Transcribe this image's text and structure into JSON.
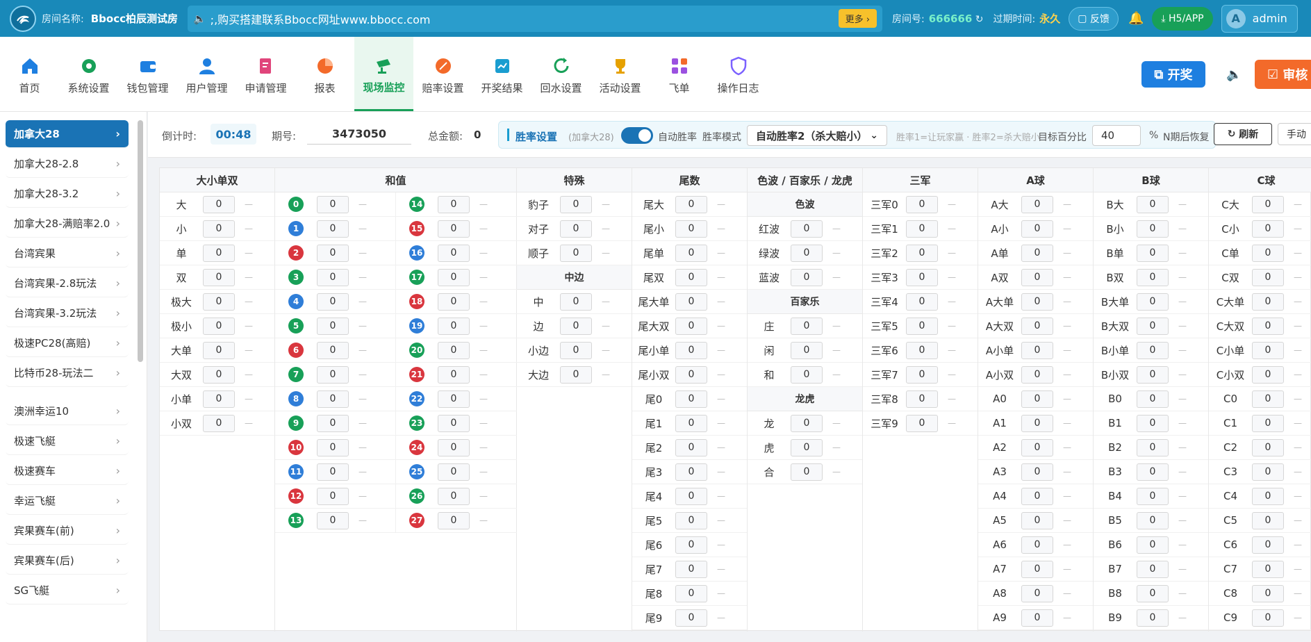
{
  "topbar": {
    "room_label": "房间名称:",
    "room_name": "Bbocc柏辰测试房",
    "marquee": ";,购买搭建联系Bbocc网址www.bbocc.com",
    "more": "更多 ›",
    "room_no_label": "房间号:",
    "room_no": "666666",
    "expire_label": "过期时间:",
    "expire": "永久",
    "feedback": "反馈",
    "app": "H5/APP",
    "user": "admin",
    "avatar": "A"
  },
  "nav": {
    "items": [
      {
        "label": "首页",
        "icon": "home-icon",
        "color": "#1e7fe0"
      },
      {
        "label": "系统设置",
        "icon": "gear-icon",
        "color": "#18a058"
      },
      {
        "label": "钱包管理",
        "icon": "wallet-icon",
        "color": "#1e7fe0"
      },
      {
        "label": "用户管理",
        "icon": "user-icon",
        "color": "#1e7fe0"
      },
      {
        "label": "申请管理",
        "icon": "edit-icon",
        "color": "#e0457b"
      },
      {
        "label": "报表",
        "icon": "pie-chart-icon",
        "color": "#f36a2a"
      },
      {
        "label": "现场监控",
        "icon": "camera-icon",
        "color": "#18a058"
      },
      {
        "label": "赔率设置",
        "icon": "odds-icon",
        "color": "#f36a2a"
      },
      {
        "label": "开奖结果",
        "icon": "result-icon",
        "color": "#1a9dd0"
      },
      {
        "label": "回水设置",
        "icon": "refresh-icon",
        "color": "#18a058"
      },
      {
        "label": "活动设置",
        "icon": "trophy-icon",
        "color": "#e6a100"
      },
      {
        "label": "飞单",
        "icon": "apps-icon",
        "color": "#9b51e0"
      },
      {
        "label": "操作日志",
        "icon": "shield-icon",
        "color": "#7b61ff"
      }
    ],
    "kaijiang": "开奖",
    "shenhe": "审核"
  },
  "sidebar": [
    {
      "label": "加拿大28",
      "active": true
    },
    {
      "label": "加拿大28-2.8"
    },
    {
      "label": "加拿大28-3.2"
    },
    {
      "label": "加拿大28-满赔率2.0"
    },
    {
      "label": "台湾宾果"
    },
    {
      "label": "台湾宾果-2.8玩法"
    },
    {
      "label": "台湾宾果-3.2玩法"
    },
    {
      "label": "极速PC28(高赔)"
    },
    {
      "label": "比特币28-玩法二"
    },
    {
      "label": "澳洲幸运10"
    },
    {
      "label": "极速飞艇"
    },
    {
      "label": "极速赛车"
    },
    {
      "label": "幸运飞艇"
    },
    {
      "label": "宾果赛车(前)"
    },
    {
      "label": "宾果赛车(后)"
    },
    {
      "label": "SG飞艇"
    }
  ],
  "toolbar": {
    "countdown_label": "倒计时:",
    "countdown": "00:48",
    "issue_label": "期号:",
    "issue": "3473050",
    "total_label": "总金额:",
    "total": "0",
    "win_title": "胜率设置",
    "win_sub": "(加拿大28)",
    "auto_win": "自动胜率",
    "win_mode": "胜率模式",
    "mode_value": "自动胜率2（杀大赔小）",
    "hint": "胜率1=让玩家赢 · 胜率2=杀大赔小",
    "target": "目标百分比",
    "target_value": "40",
    "pct": "%",
    "recover": "N期后恢复",
    "refresh": "刷新",
    "manual": "手动"
  },
  "grid": {
    "dxds": {
      "title": "大小单双",
      "rows": [
        "大",
        "小",
        "单",
        "双",
        "极大",
        "极小",
        "大单",
        "大双",
        "小单",
        "小双"
      ]
    },
    "hezhi": {
      "title": "和值",
      "left": [
        {
          "n": "0",
          "c": "green"
        },
        {
          "n": "1",
          "c": "blue"
        },
        {
          "n": "2",
          "c": "red"
        },
        {
          "n": "3",
          "c": "green"
        },
        {
          "n": "4",
          "c": "blue"
        },
        {
          "n": "5",
          "c": "green"
        },
        {
          "n": "6",
          "c": "red"
        },
        {
          "n": "7",
          "c": "green"
        },
        {
          "n": "8",
          "c": "blue"
        },
        {
          "n": "9",
          "c": "green"
        },
        {
          "n": "10",
          "c": "red"
        },
        {
          "n": "11",
          "c": "blue"
        },
        {
          "n": "12",
          "c": "red"
        },
        {
          "n": "13",
          "c": "green"
        }
      ],
      "right": [
        {
          "n": "14",
          "c": "green"
        },
        {
          "n": "15",
          "c": "red"
        },
        {
          "n": "16",
          "c": "blue"
        },
        {
          "n": "17",
          "c": "green"
        },
        {
          "n": "18",
          "c": "red"
        },
        {
          "n": "19",
          "c": "blue"
        },
        {
          "n": "20",
          "c": "green"
        },
        {
          "n": "21",
          "c": "red"
        },
        {
          "n": "22",
          "c": "blue"
        },
        {
          "n": "23",
          "c": "green"
        },
        {
          "n": "24",
          "c": "red"
        },
        {
          "n": "25",
          "c": "blue"
        },
        {
          "n": "26",
          "c": "green"
        },
        {
          "n": "27",
          "c": "red"
        }
      ]
    },
    "teshu": {
      "title": "特殊",
      "rows": [
        "豹子",
        "对子",
        "顺子"
      ],
      "sub_title": "中边",
      "sub_rows": [
        "中",
        "边",
        "小边",
        "大边"
      ]
    },
    "weishu": {
      "title": "尾数",
      "rows": [
        "尾大",
        "尾小",
        "尾单",
        "尾双",
        "尾大单",
        "尾大双",
        "尾小单",
        "尾小双",
        "尾0",
        "尾1",
        "尾2",
        "尾3",
        "尾4",
        "尾5",
        "尾6",
        "尾7",
        "尾8",
        "尾9"
      ]
    },
    "sebo": {
      "title": "色波 / 百家乐 / 龙虎",
      "groups": [
        {
          "title": "色波",
          "rows": [
            "红波",
            "绿波",
            "蓝波"
          ]
        },
        {
          "title": "百家乐",
          "rows": [
            "庄",
            "闲",
            "和"
          ]
        },
        {
          "title": "龙虎",
          "rows": [
            "龙",
            "虎",
            "合"
          ]
        }
      ]
    },
    "sanjun": {
      "title": "三军",
      "rows": [
        "三军0",
        "三军1",
        "三军2",
        "三军3",
        "三军4",
        "三军5",
        "三军6",
        "三军7",
        "三军8",
        "三军9"
      ]
    },
    "aball": {
      "title": "A球",
      "rows": [
        "A大",
        "A小",
        "A单",
        "A双",
        "A大单",
        "A大双",
        "A小单",
        "A小双",
        "A0",
        "A1",
        "A2",
        "A3",
        "A4",
        "A5",
        "A6",
        "A7",
        "A8",
        "A9"
      ]
    },
    "bball": {
      "title": "B球",
      "rows": [
        "B大",
        "B小",
        "B单",
        "B双",
        "B大单",
        "B大双",
        "B小单",
        "B小双",
        "B0",
        "B1",
        "B2",
        "B3",
        "B4",
        "B5",
        "B6",
        "B7",
        "B8",
        "B9"
      ]
    },
    "cball": {
      "title": "C球",
      "rows": [
        "C大",
        "C小",
        "C单",
        "C双",
        "C大单",
        "C大双",
        "C小单",
        "C小双",
        "C0",
        "C1",
        "C2",
        "C3",
        "C4",
        "C5",
        "C6",
        "C7",
        "C8",
        "C9"
      ]
    },
    "value": "0",
    "dash": "—"
  }
}
